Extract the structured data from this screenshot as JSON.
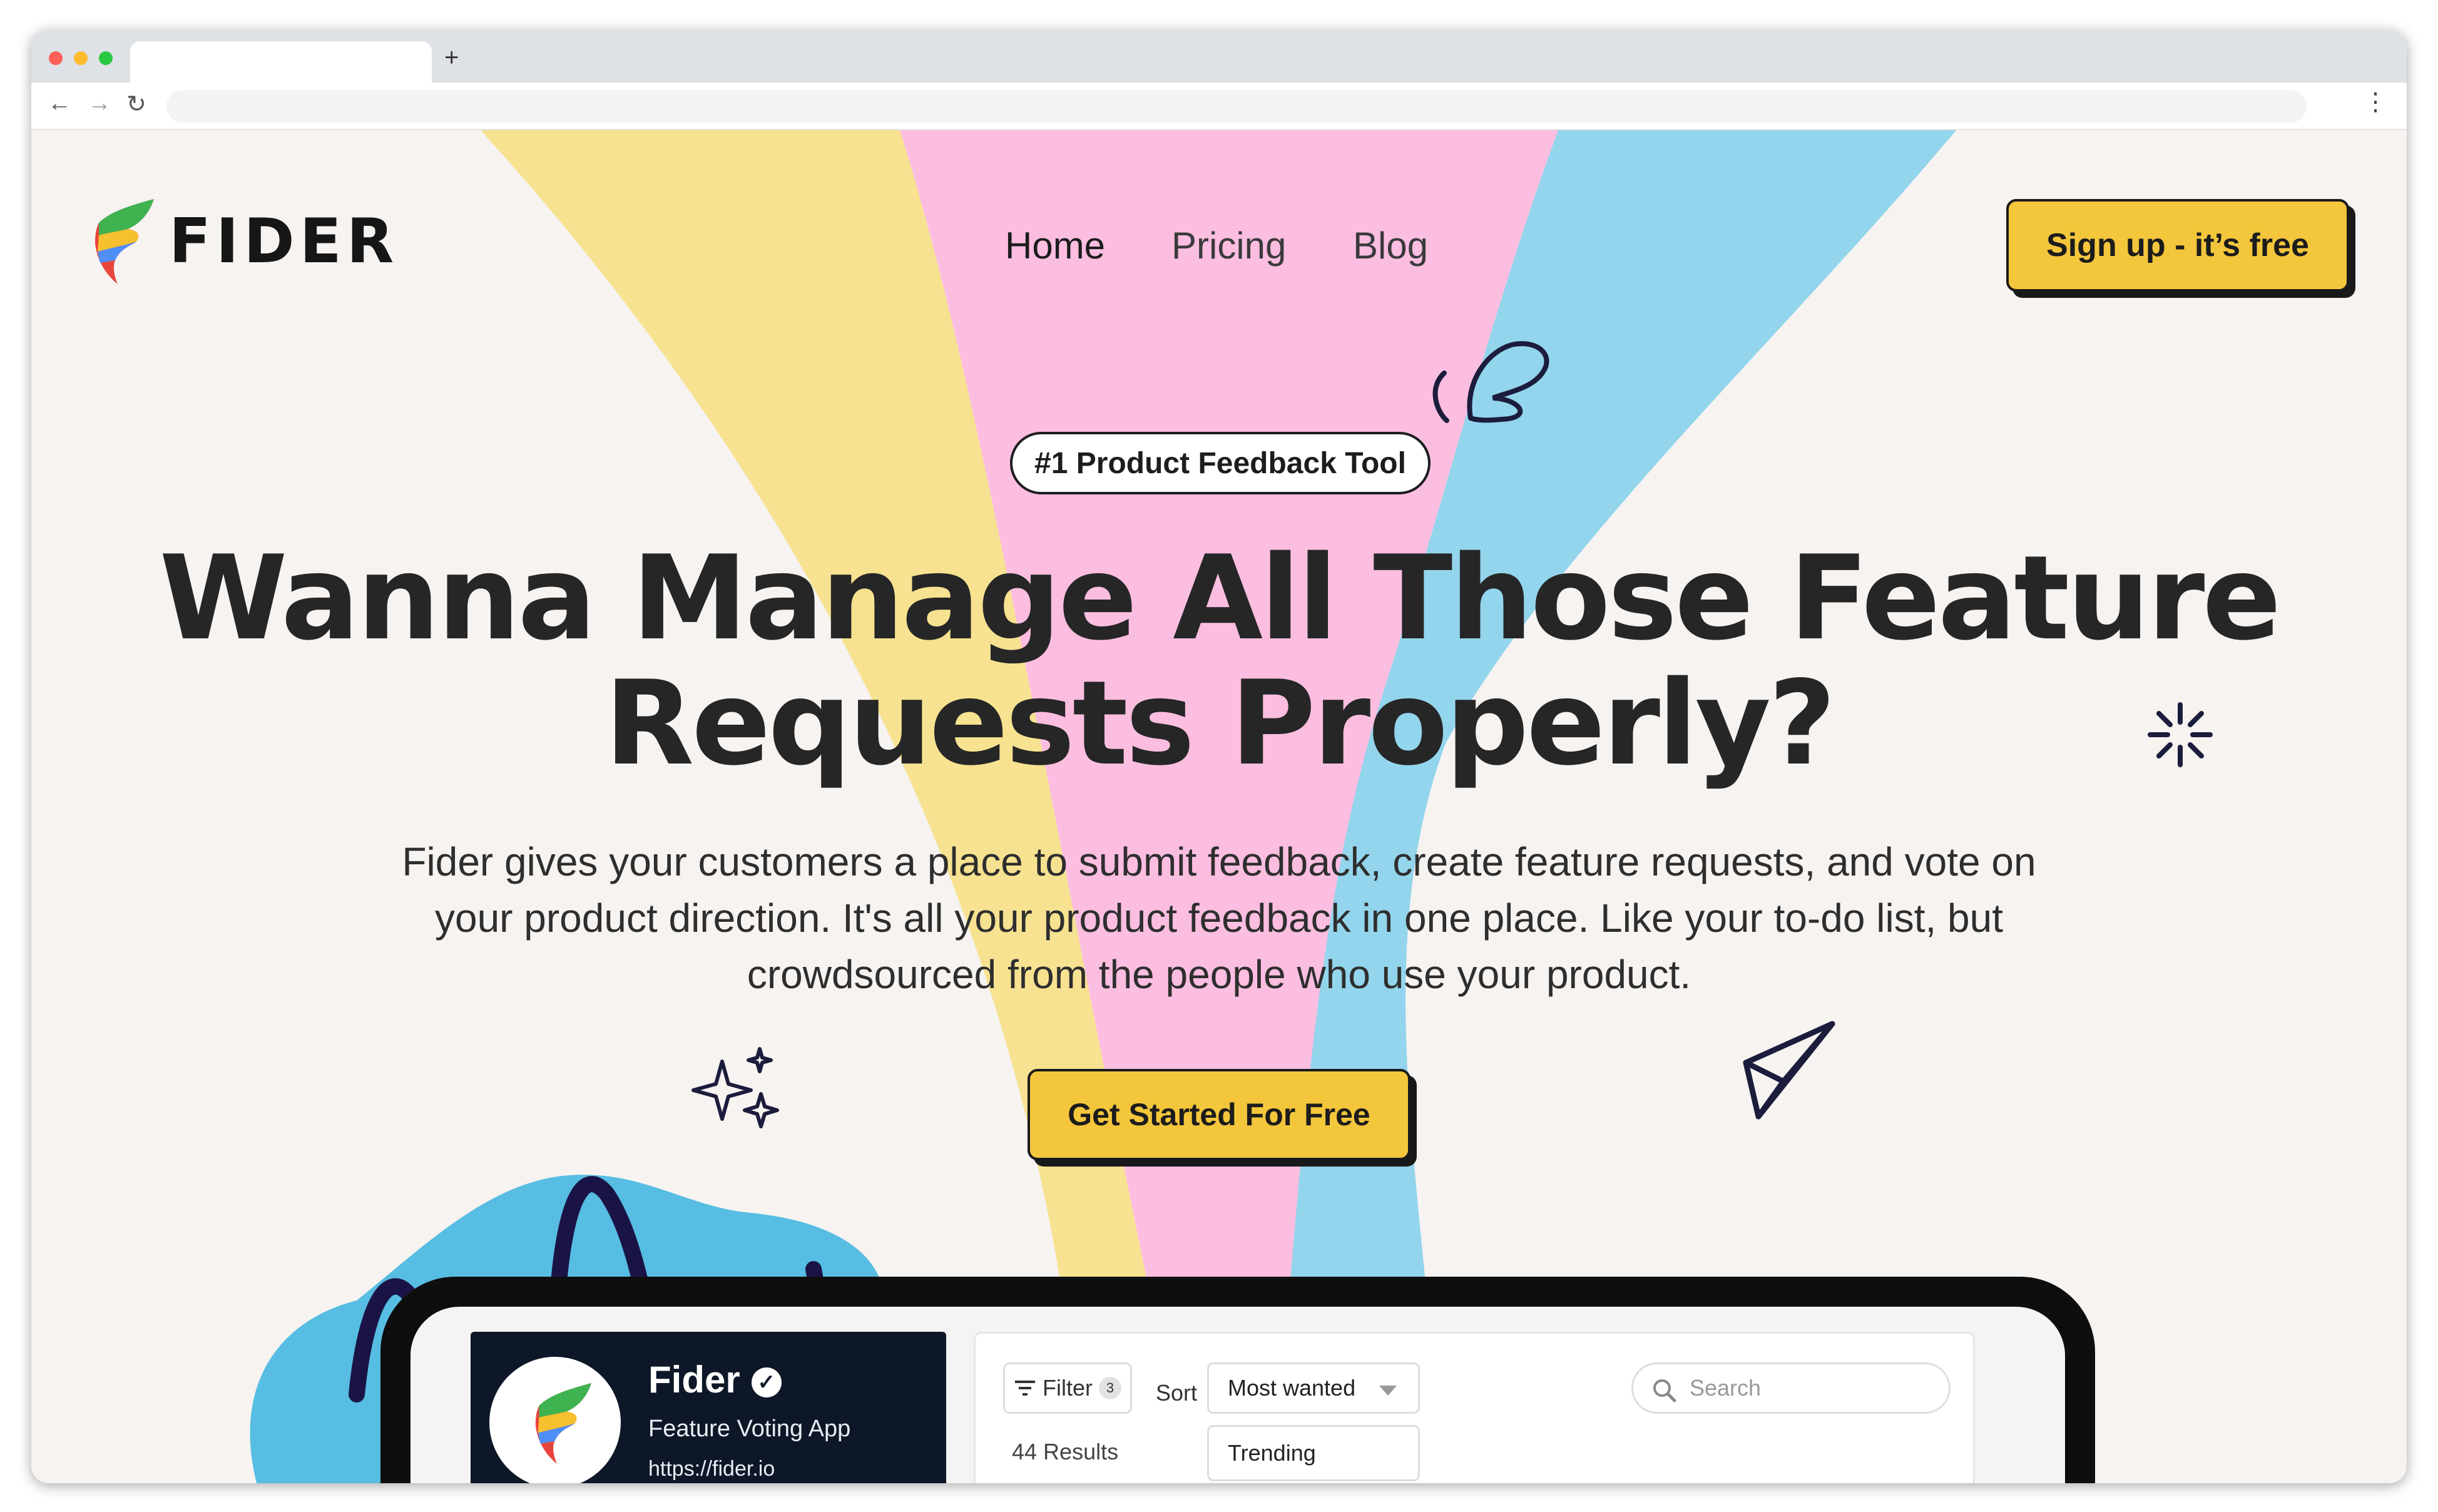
{
  "browser": {
    "tab_title": "",
    "new_tab_glyph": "+",
    "back_glyph": "←",
    "forward_glyph": "→",
    "reload_glyph": "↻",
    "menu_glyph": "⋮"
  },
  "brand": {
    "name": "FIDER",
    "logo_icon": "fider-flame-logo",
    "accent": "#f4c63c",
    "stripe_colors": [
      "#f7e291",
      "#fbbee0",
      "#93d5ec"
    ],
    "blob_color": "#57bde2"
  },
  "nav": {
    "items": [
      {
        "label": "Home",
        "active": true
      },
      {
        "label": "Pricing",
        "active": false
      },
      {
        "label": "Blog",
        "active": false
      }
    ],
    "signup_label": "Sign up - it’s free"
  },
  "hero": {
    "badge": "#1 Product Feedback Tool",
    "headline_line1": "Wanna Manage All Those Feature",
    "headline_line2": "Requests Properly?",
    "subtitle": "Fider gives your customers a place to submit feedback, create feature requests, and vote on your product direction. It's all your product feedback in one place. Like your to-do list, but crowdsourced from the people who use your product.",
    "cta_label": "Get Started For Free",
    "decorations": [
      "splash-icon",
      "sparkle-burst-icon",
      "stars-icon",
      "paper-plane-icon"
    ]
  },
  "preview": {
    "site_name": "Fider",
    "verified_glyph": "✓",
    "site_description": "Feature Voting App",
    "site_url": "https://fider.io",
    "filter_label": "Filter",
    "filter_count": "3",
    "sort_label": "Sort",
    "sort_value": "Most wanted",
    "results": "44 Results",
    "sort_option": "Trending",
    "search_placeholder": "Search"
  }
}
